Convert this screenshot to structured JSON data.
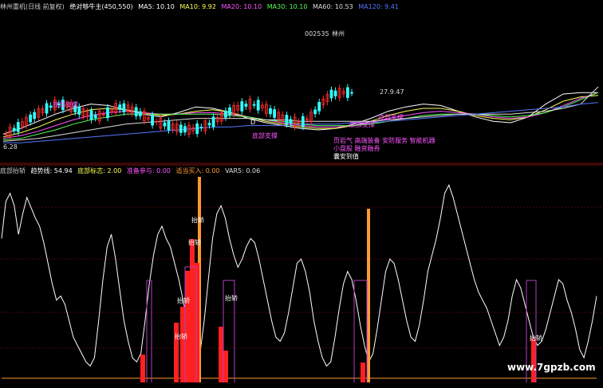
{
  "header": {
    "title": "林州重机(日线 前复权)",
    "indicator": "绝对够牛主(450,550)",
    "ma5": "MA5: 10.10",
    "ma10": "MA10: 9.92",
    "ma20": "MA20: 10.10",
    "ma30": "MA30: 10.10",
    "ma60": "MA60: 10.53",
    "ma120": "MA120: 9.41"
  },
  "stock_code": "002535",
  "stock_name_short": "林州",
  "panel2": {
    "name": "底部抬轿",
    "trend": "趋势线: 54.94",
    "bottom": "底部标志: 2.00",
    "prep": "准备参与: 0.00",
    "buy": "适当买入: 0.00",
    "var5": "VAR5: 0.06"
  },
  "price_labels": {
    "low_marker": "6.28",
    "right_marker": "27.9.47"
  },
  "annotations": {
    "support1": "底部支撑",
    "support2": "底部支撑",
    "support3": "底部支撑",
    "support4": "底部支撑",
    "concepts_line1": "页岩气 高端装备 安防服务 智能机器",
    "concepts_line2": "小盘股 融资融券",
    "concepts_line3": "囊安到值",
    "d_mark": "D"
  },
  "lift_labels": [
    "抬轿",
    "抬轿",
    "抬轿",
    "抬轿",
    "抬轿",
    "抬轿"
  ],
  "watermark": "www.7gpzb.com",
  "colors": {
    "bg": "#000000",
    "up": "#ff2a2a",
    "down": "#33ffff",
    "ma5": "#ffffff",
    "ma10": "#ffff55",
    "ma20": "#ff55ff",
    "ma30": "#55ff55",
    "ma60": "#dddddd",
    "ma120": "#5577ff",
    "trend": "#ffffff",
    "orange": "#ff9933",
    "purple": "#b040c0",
    "red_bar": "#ff2020",
    "grid": "#7a1010"
  },
  "chart_data": [
    {
      "type": "line",
      "title": "林州重机(日线 前复权)",
      "series": [
        {
          "name": "MA5",
          "values": [
            7.2,
            7.6,
            8.1,
            8.6,
            9.0,
            9.3,
            9.2,
            8.9,
            8.6,
            8.4,
            8.7,
            9.1,
            9.0,
            8.7,
            8.3,
            8.0,
            7.8,
            7.6,
            7.5,
            7.6,
            7.9,
            8.3,
            8.8,
            9.1,
            9.3,
            9.2,
            8.8,
            8.4,
            8.1,
            8.0,
            8.4,
            9.3,
            10.0,
            10.1,
            10.1
          ]
        },
        {
          "name": "MA10",
          "values": [
            7.0,
            7.3,
            7.7,
            8.2,
            8.6,
            8.9,
            9.0,
            8.9,
            8.7,
            8.5,
            8.6,
            8.8,
            8.9,
            8.7,
            8.4,
            8.1,
            7.9,
            7.7,
            7.6,
            7.6,
            7.8,
            8.1,
            8.5,
            8.8,
            9.0,
            9.0,
            8.8,
            8.5,
            8.3,
            8.2,
            8.4,
            8.9,
            9.5,
            9.8,
            9.9
          ]
        },
        {
          "name": "MA20",
          "values": [
            6.9,
            7.1,
            7.4,
            7.8,
            8.2,
            8.5,
            8.7,
            8.8,
            8.7,
            8.6,
            8.6,
            8.7,
            8.7,
            8.6,
            8.4,
            8.2,
            8.0,
            7.8,
            7.7,
            7.7,
            7.8,
            8.0,
            8.3,
            8.5,
            8.7,
            8.8,
            8.7,
            8.6,
            8.4,
            8.3,
            8.4,
            8.7,
            9.2,
            9.7,
            10.1
          ]
        },
        {
          "name": "MA30",
          "values": [
            6.8,
            6.9,
            7.2,
            7.5,
            7.9,
            8.2,
            8.4,
            8.6,
            8.6,
            8.6,
            8.6,
            8.6,
            8.6,
            8.5,
            8.4,
            8.2,
            8.1,
            7.9,
            7.8,
            7.8,
            7.8,
            7.9,
            8.1,
            8.3,
            8.5,
            8.6,
            8.6,
            8.6,
            8.5,
            8.4,
            8.5,
            8.7,
            9.1,
            9.6,
            10.1
          ]
        },
        {
          "name": "MA60",
          "values": [
            6.7,
            6.8,
            6.9,
            7.1,
            7.3,
            7.5,
            7.7,
            7.9,
            8.0,
            8.1,
            8.2,
            8.3,
            8.3,
            8.3,
            8.3,
            8.2,
            8.2,
            8.1,
            8.1,
            8.1,
            8.1,
            8.1,
            8.2,
            8.3,
            8.4,
            8.5,
            8.6,
            8.6,
            8.6,
            8.6,
            8.7,
            8.8,
            9.0,
            9.3,
            10.5
          ]
        },
        {
          "name": "MA120",
          "values": [
            6.6,
            6.6,
            6.7,
            6.8,
            6.9,
            7.0,
            7.1,
            7.2,
            7.3,
            7.4,
            7.5,
            7.6,
            7.7,
            7.7,
            7.8,
            7.8,
            7.8,
            7.9,
            7.9,
            7.9,
            8.0,
            8.0,
            8.1,
            8.2,
            8.3,
            8.4,
            8.5,
            8.6,
            8.7,
            8.8,
            8.9,
            9.0,
            9.1,
            9.3,
            9.4
          ]
        }
      ]
    },
    {
      "type": "line",
      "title": "底部抬轿",
      "ylim": [
        0,
        100
      ],
      "series": [
        {
          "name": "趋势线",
          "values": [
            70,
            88,
            92,
            86,
            72,
            82,
            90,
            85,
            80,
            76,
            68,
            58,
            48,
            40,
            42,
            38,
            30,
            22,
            18,
            14,
            10,
            8,
            12,
            30,
            50,
            66,
            72,
            60,
            45,
            30,
            20,
            12,
            10,
            14,
            30,
            48,
            62,
            72,
            76,
            70,
            66,
            58,
            50,
            40,
            30,
            18,
            10,
            14,
            30,
            50,
            70,
            82,
            86,
            80,
            70,
            62,
            56,
            60,
            66,
            70,
            68,
            60,
            50,
            40,
            30,
            22,
            20,
            24,
            34,
            46,
            58,
            60,
            54,
            44,
            30,
            20,
            12,
            8,
            10,
            22,
            36,
            48,
            54,
            50,
            40,
            28,
            18,
            10,
            14,
            26,
            40,
            54,
            60,
            58,
            50,
            40,
            30,
            22,
            20,
            28,
            40,
            54,
            62,
            70,
            80,
            92,
            96,
            90,
            82,
            74,
            66,
            58,
            50,
            44,
            40,
            36,
            30,
            24,
            18,
            22,
            30,
            42,
            50,
            46,
            38,
            30,
            22,
            18,
            20,
            26,
            34,
            42,
            50,
            48,
            40,
            34,
            26,
            16,
            12,
            20,
            30,
            42
          ]
        },
        {
          "name": "底部标志",
          "values": [
            2,
            2,
            2,
            2,
            2,
            2,
            2,
            2,
            2,
            2,
            2,
            2,
            2,
            2,
            2,
            2,
            2,
            2,
            2,
            2,
            2,
            2,
            2,
            2,
            2,
            2,
            2,
            2,
            2,
            2,
            2,
            2,
            2,
            2,
            2,
            2,
            2,
            2,
            2,
            2,
            2,
            2,
            2,
            2,
            2,
            2,
            2,
            2,
            2,
            2,
            2,
            2,
            2,
            2,
            2,
            2,
            2,
            2,
            2,
            2,
            2,
            2,
            2,
            2,
            2,
            2,
            2,
            2,
            2,
            2,
            2,
            2,
            2,
            2,
            2,
            2,
            2,
            2,
            2,
            2,
            2,
            2,
            2,
            2,
            2,
            2,
            2,
            2,
            2,
            2,
            2,
            2,
            2,
            2,
            2,
            2,
            2,
            2,
            2,
            2,
            2,
            2,
            2,
            2,
            2,
            2,
            2,
            2,
            2,
            2,
            2,
            2,
            2,
            2,
            2,
            2,
            2,
            2,
            2,
            2,
            2,
            2,
            2,
            2,
            2,
            2,
            2,
            2,
            2,
            2,
            2,
            2,
            2,
            2,
            2,
            2,
            2,
            2,
            2,
            2,
            2,
            2
          ]
        }
      ]
    }
  ]
}
